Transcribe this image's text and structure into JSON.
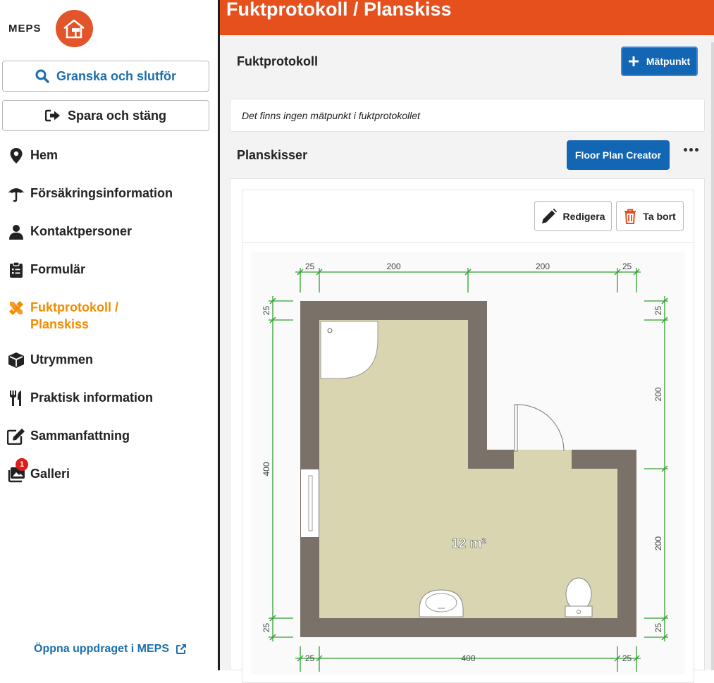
{
  "brand": {
    "name": "MEPS",
    "accent": "#e2552a"
  },
  "sidebar": {
    "review_label": "Granska och slutför",
    "save_label": "Spara och stäng",
    "items": [
      {
        "label": "Hem",
        "icon": "map-pin-icon",
        "active": false
      },
      {
        "label": "Försäkringsinformation",
        "icon": "umbrella-icon",
        "active": false
      },
      {
        "label": "Kontaktpersoner",
        "icon": "person-icon",
        "active": false
      },
      {
        "label": "Formulär",
        "icon": "clipboard-icon",
        "active": false
      },
      {
        "label": "Fuktprotokoll /",
        "label2": "Planskiss",
        "icon": "ruler-pencil-icon",
        "active": true
      },
      {
        "label": "Utrymmen",
        "icon": "cube-icon",
        "active": false
      },
      {
        "label": "Praktisk information",
        "icon": "utensils-icon",
        "active": false
      },
      {
        "label": "Sammanfattning",
        "icon": "edit-icon",
        "active": false
      },
      {
        "label": "Galleri",
        "icon": "gallery-icon",
        "active": false,
        "badge": "1"
      }
    ],
    "open_link": "Öppna uppdraget i MEPS"
  },
  "header": {
    "title": "Fuktprotokoll / Planskiss",
    "color": "#e5501c"
  },
  "moisture": {
    "title": "Fuktprotokoll",
    "add_button": "Mätpunkt",
    "empty_text": "Det finns ingen mätpunkt i fuktprotokollet"
  },
  "sketches": {
    "title": "Planskisser",
    "fpc_button": "Floor Plan Creator",
    "edit_button": "Redigera",
    "delete_button": "Ta bort"
  },
  "floorplan": {
    "area_label": "12 m²",
    "dims_top": [
      "25",
      "200",
      "200",
      "25"
    ],
    "dims_bottom": [
      "25",
      "400",
      "25"
    ],
    "dims_left": [
      "25",
      "400",
      "25"
    ],
    "dims_right": [
      "25",
      "200",
      "200",
      "25"
    ],
    "wall_color": "#7a7168",
    "floor_color": "#d9d5b1",
    "dim_color": "#2ea02e"
  }
}
